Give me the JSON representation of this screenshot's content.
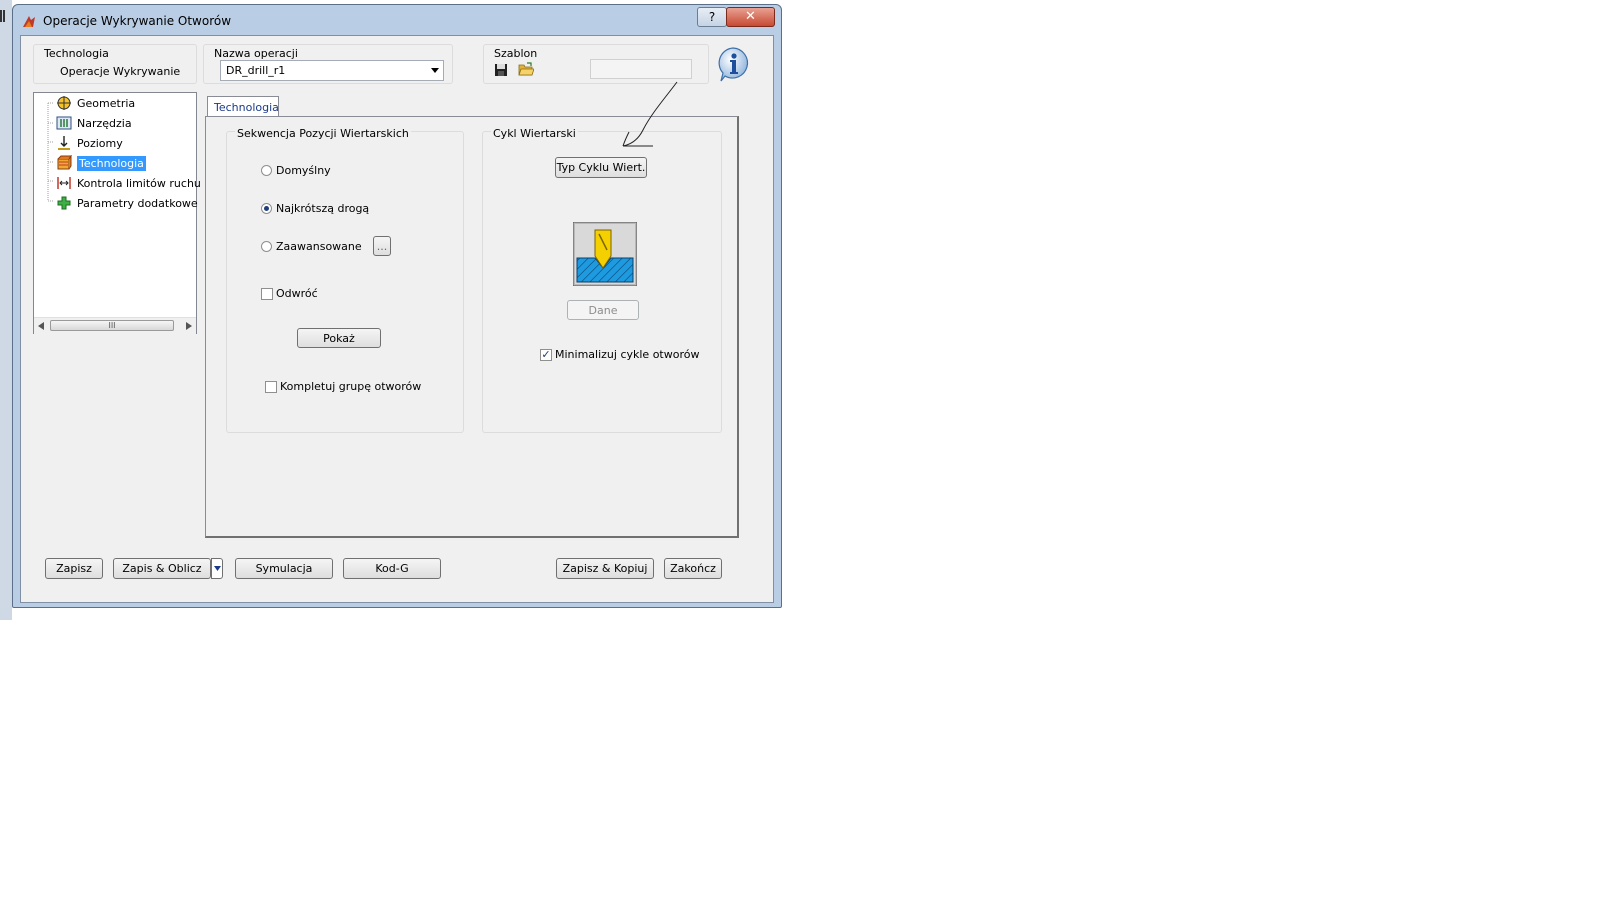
{
  "window": {
    "title": "Operacje Wykrywanie Otworów",
    "help_label": "?",
    "close_label": "✕"
  },
  "header": {
    "technologia_label": "Technologia",
    "technologia_value": "Operacje Wykrywanie",
    "operation_name_label": "Nazwa operacji",
    "operation_name_value": "DR_drill_r1",
    "template_label": "Szablon",
    "template_field_value": ""
  },
  "tree": {
    "items": [
      {
        "label": "Geometria",
        "icon": "geometry-icon"
      },
      {
        "label": "Narzędzia",
        "icon": "tools-icon"
      },
      {
        "label": "Poziomy",
        "icon": "levels-icon"
      },
      {
        "label": "Technologia",
        "icon": "technology-icon",
        "selected": true
      },
      {
        "label": "Kontrola limitów ruchu",
        "icon": "motion-limits-icon"
      },
      {
        "label": "Parametry dodatkowe",
        "icon": "add-params-icon"
      }
    ],
    "scroll_grip": "III"
  },
  "tabs": [
    {
      "label": "Technologia",
      "active": true
    }
  ],
  "sequence_group": {
    "title": "Sekwencja Pozycji Wiertarskich",
    "radios": [
      {
        "label": "Domyślny",
        "checked": false
      },
      {
        "label": "Najkrótszą drogą",
        "checked": true
      },
      {
        "label": "Zaawansowane",
        "checked": false
      }
    ],
    "advanced_button": "...",
    "reverse_label": "Odwróć",
    "reverse_checked": false,
    "show_button": "Pokaż",
    "complete_label": "Kompletuj grupę otworów",
    "complete_checked": false
  },
  "cycle_group": {
    "title": "Cykl Wiertarski",
    "cycle_type_button": "Typ Cyklu Wiert.",
    "data_button": "Dane",
    "minimize_label": "Minimalizuj cykle otworów",
    "minimize_checked": true
  },
  "footer": {
    "save": "Zapisz",
    "save_calc": "Zapis & Oblicz",
    "simulation": "Symulacja",
    "gcode": "Kod-G",
    "save_copy": "Zapisz & Kopiuj",
    "finish": "Zakończ"
  },
  "colors": {
    "selection": "#3399ff",
    "title_bar": "#b9cde4",
    "tab_text": "#1a3a8a"
  }
}
